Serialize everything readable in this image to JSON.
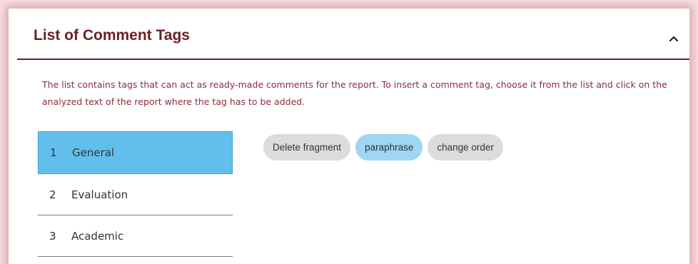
{
  "panel": {
    "title": "List of Comment Tags",
    "collapse_icon": "chevron-up-icon",
    "description": "The list contains tags that can act as ready-made comments for the report. To insert a comment tag, choose it from the list and click on the analyzed text of the report where the tag has to be added."
  },
  "categories": [
    {
      "number": "1",
      "label": "General",
      "active": true
    },
    {
      "number": "2",
      "label": "Evaluation",
      "active": false
    },
    {
      "number": "3",
      "label": "Academic",
      "active": false
    }
  ],
  "tags": [
    {
      "label": "Delete fragment",
      "selected": false
    },
    {
      "label": "paraphrase",
      "selected": true
    },
    {
      "label": "change order",
      "selected": false
    }
  ],
  "colors": {
    "accent": "#6e1e24",
    "active_category": "#62bfec",
    "selected_tag": "#9fd6f2",
    "tag": "#dcdcdc"
  }
}
